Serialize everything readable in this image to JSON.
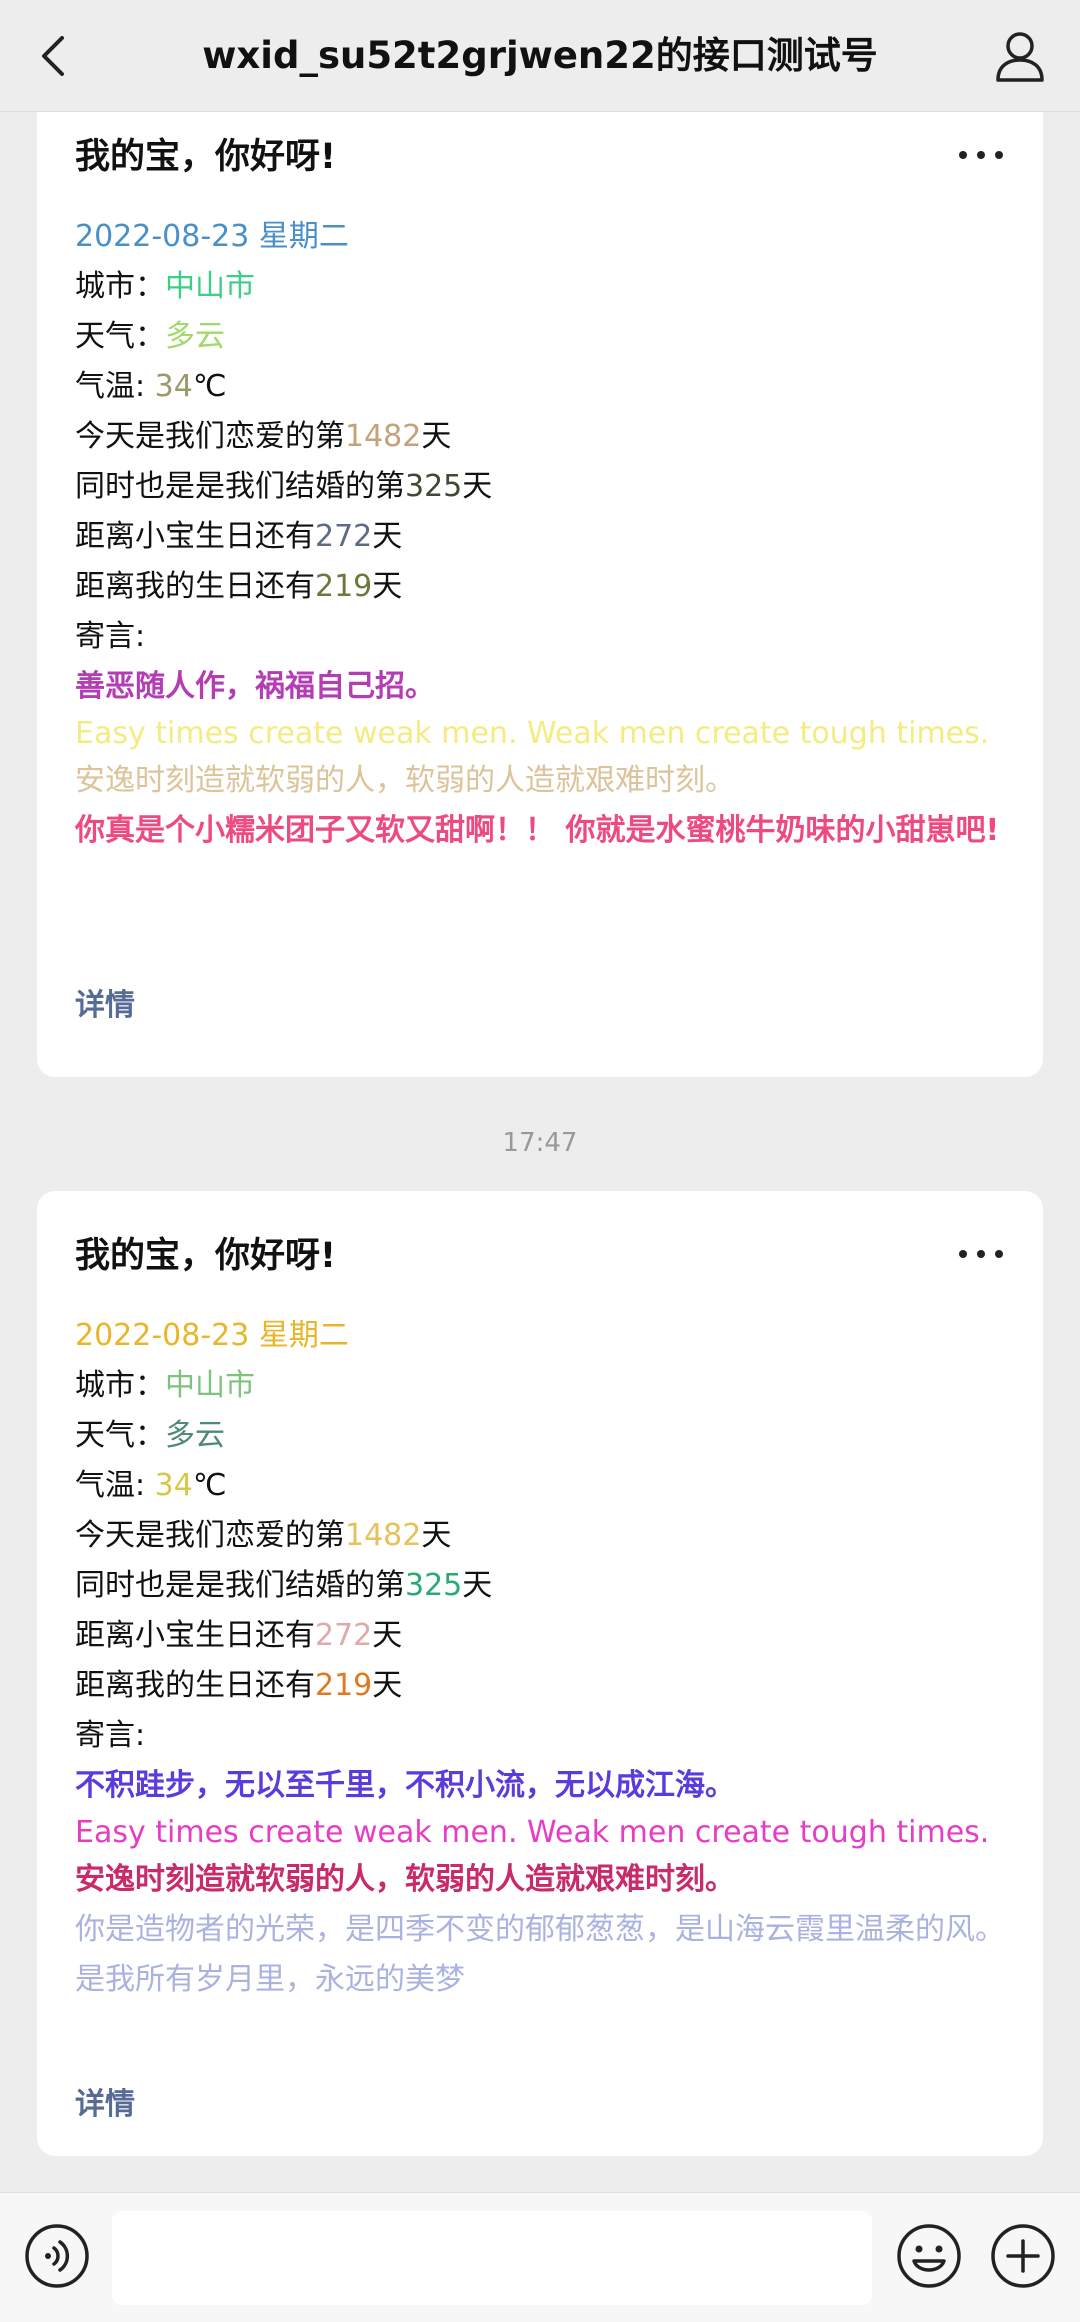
{
  "header": {
    "title": "wxid_su52t2grjwen22的接口测试号"
  },
  "messages": [
    {
      "title": "我的宝，你好呀!",
      "date": "2022-08-23 星期二",
      "date_color": "#4a90c8",
      "city_label": "城市：",
      "city": "中山市",
      "city_color": "#3ccf86",
      "weather_label": "天气：",
      "weather": "多云",
      "weather_color": "#a3d86a",
      "temp_label": "气温: ",
      "temp": "34",
      "temp_color": "#9b9a6a",
      "temp_unit": "℃",
      "love_prefix": "今天是我们恋爱的第",
      "love_days": "1482",
      "love_color": "#c4a27a",
      "marry_prefix": "同时也是是我们结婚的第",
      "marry_days": "325",
      "marry_color": "#3f4a36",
      "bday1_prefix": "距离小宝生日还有",
      "bday1_days": "272",
      "bday1_color": "#5f6b86",
      "bday2_prefix": "距离我的生日还有",
      "bday2_days": "219",
      "bday2_color": "#6a7a3c",
      "day_suffix": "天",
      "note_label": "寄言:",
      "quote": "善恶随人作，祸福自己招。",
      "quote_color": "#b43cb4",
      "english": "Easy times create weak men. Weak men create tough times.",
      "english_color": "#f4ec82",
      "chinese": "安逸时刻造就软弱的人，软弱的人造就艰难时刻。",
      "chinese_color": "#dcc39a",
      "love_note": "你真是个小糯米团子又软又甜啊！！ 你就是水蜜桃牛奶味的小甜崽吧!",
      "love_note_color": "#ee4a82",
      "detail": "详情"
    },
    {
      "title": "我的宝，你好呀!",
      "date": "2022-08-23 星期二",
      "date_color": "#e8b628",
      "city_label": "城市：",
      "city": "中山市",
      "city_color": "#7ec27e",
      "weather_label": "天气：",
      "weather": "多云",
      "weather_color": "#4f8a78",
      "temp_label": "气温: ",
      "temp": "34",
      "temp_color": "#d8c84a",
      "temp_unit": "℃",
      "love_prefix": "今天是我们恋爱的第",
      "love_days": "1482",
      "love_color": "#e6c25a",
      "marry_prefix": "同时也是是我们结婚的第",
      "marry_days": "325",
      "marry_color": "#2aaa72",
      "bday1_prefix": "距离小宝生日还有",
      "bday1_days": "272",
      "bday1_color": "#e0aaaa",
      "bday2_prefix": "距离我的生日还有",
      "bday2_days": "219",
      "bday2_color": "#e07a1e",
      "day_suffix": "天",
      "note_label": "寄言:",
      "quote": "不积跬步，无以至千里，不积小流，无以成江海。",
      "quote_color": "#5a3cdc",
      "english": "Easy times create weak men. Weak men create tough times.",
      "english_color": "#e83cc4",
      "chinese": "安逸时刻造就软弱的人，软弱的人造就艰难时刻。",
      "chinese_color": "#c82a6a",
      "love_note": "你是造物者的光荣，是四季不变的郁郁葱葱，是山海云霞里温柔的风。是我所有岁月里，永远的美梦",
      "love_note_color": "#aab2e0",
      "detail": "详情"
    }
  ],
  "timestamp": "17:47"
}
